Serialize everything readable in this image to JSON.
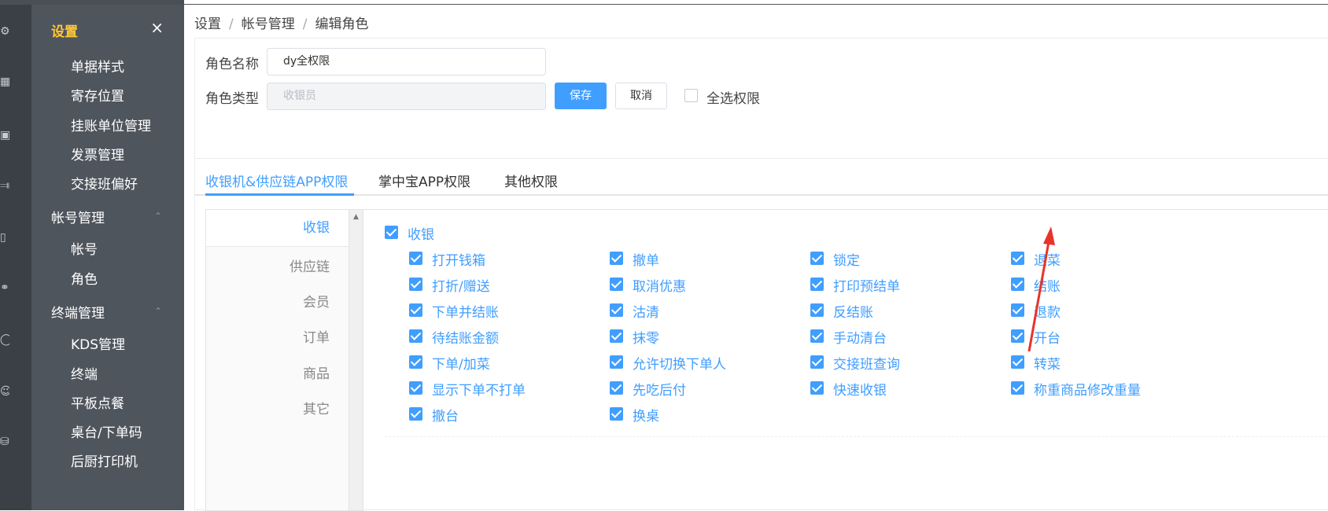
{
  "sidebar": {
    "title": "设置",
    "close_icon": "×",
    "items_top": [
      "单据样式",
      "寄存位置",
      "挂账单位管理",
      "发票管理",
      "交接班偏好"
    ],
    "group_account": "帐号管理",
    "items_account": [
      "帐号",
      "角色"
    ],
    "group_terminal": "终端管理",
    "items_terminal": [
      "KDS管理",
      "终端",
      "平板点餐",
      "桌台/下单码",
      "后厨打印机"
    ],
    "caret_icon": "chevron-up-icon"
  },
  "breadcrumb": [
    "设置",
    "帐号管理",
    "编辑角色"
  ],
  "form": {
    "role_name_label": "角色名称",
    "role_name_value": "dy全权限",
    "role_type_label": "角色类型",
    "role_type_placeholder": "收银员",
    "save_label": "保存",
    "cancel_label": "取消",
    "select_all_label": "全选权限"
  },
  "tabs": [
    "收银机&供应链APP权限",
    "掌中宝APP权限",
    "其他权限"
  ],
  "nav": [
    "收银",
    "供应链",
    "会员",
    "订单",
    "商品",
    "其它"
  ],
  "section_title": "收银",
  "permissions": [
    [
      "打开钱箱",
      "撤单",
      "锁定",
      "退菜"
    ],
    [
      "打折/赠送",
      "取消优惠",
      "打印预结单",
      "结账"
    ],
    [
      "下单并结账",
      "沽清",
      "反结账",
      "退款"
    ],
    [
      "待结账金额",
      "抹零",
      "手动清台",
      "开台"
    ],
    [
      "下单/加菜",
      "允许切换下单人",
      "交接班查询",
      "转菜"
    ],
    [
      "显示下单不打单",
      "先吃后付",
      "快速收银",
      "称重商品修改重量"
    ],
    [
      "撤台",
      "换桌"
    ]
  ],
  "colors": {
    "accent": "#409eff",
    "sidebar_bg": "#4f555d",
    "sidebar_title": "#ffc733",
    "annotation_arrow": "#e8332a"
  }
}
